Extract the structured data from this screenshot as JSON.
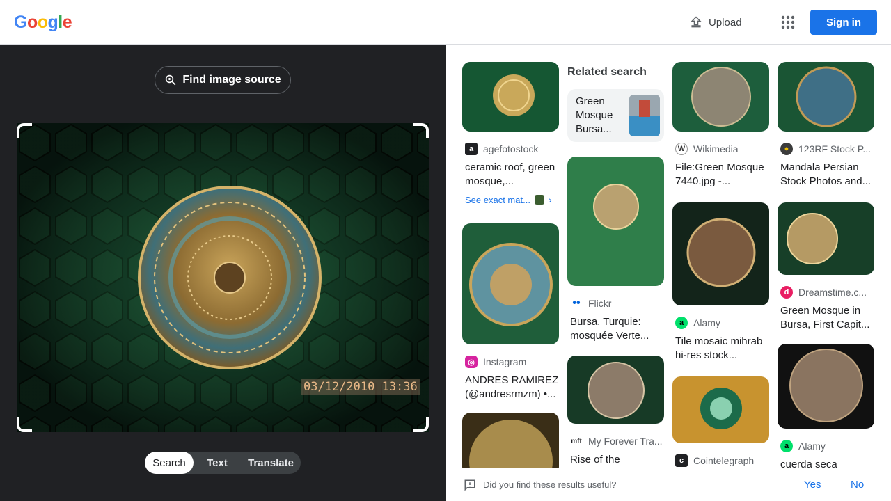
{
  "header": {
    "logo_letters": [
      "G",
      "o",
      "o",
      "g",
      "l",
      "e"
    ],
    "logo_colors": [
      "#4285f4",
      "#ea4335",
      "#fbbc05",
      "#4285f4",
      "#34a853",
      "#ea4335"
    ],
    "upload_label": "Upload",
    "signin_label": "Sign in"
  },
  "left": {
    "find_source_label": "Find image source",
    "timestamp": "03/12/2010 13:36",
    "tabs": [
      "Search",
      "Text",
      "Translate"
    ],
    "active_tab": "Search"
  },
  "results": {
    "related_title": "Related search",
    "related_chip": "Green Mosque Bursa...",
    "exact_label": "See exact mat...",
    "items": [
      {
        "source": "agefotostock",
        "title": "ceramic roof, green mosque,..."
      },
      {
        "source": "Instagram",
        "title": "ANDRES RAMIREZ (@andresrmzm) •..."
      },
      {
        "source": "Flickr",
        "title": "Bursa, Turquie: mosquée Verte..."
      },
      {
        "source": "My Forever Tra...",
        "title": "Rise of the"
      },
      {
        "source": "Wikimedia",
        "title": "File:Green Mosque 7440.jpg -..."
      },
      {
        "source": "Alamy",
        "title": "Tile mosaic mihrab hi-res stock..."
      },
      {
        "source": "Cointelegraph",
        "title": ""
      },
      {
        "source": "123RF Stock P...",
        "title": "Mandala Persian Stock Photos and..."
      },
      {
        "source": "Dreamstime.c...",
        "title": "Green Mosque in Bursa, First Capit..."
      },
      {
        "source": "Alamy",
        "title": "cuerda seca"
      }
    ]
  },
  "feedback": {
    "question": "Did you find these results useful?",
    "yes": "Yes",
    "no": "No"
  }
}
